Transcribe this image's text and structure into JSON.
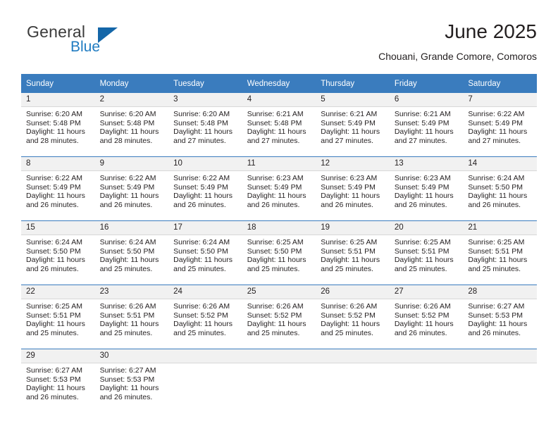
{
  "brand": {
    "name_part1": "General",
    "name_part2": "Blue",
    "accent_color": "#1f7bc1",
    "sail_color": "#1466a8"
  },
  "header": {
    "title": "June 2025",
    "subtitle": "Chouani, Grande Comore, Comoros"
  },
  "calendar": {
    "header_bg": "#3a7cbe",
    "daynum_bg": "#f1f1f1",
    "weekdays": [
      "Sunday",
      "Monday",
      "Tuesday",
      "Wednesday",
      "Thursday",
      "Friday",
      "Saturday"
    ],
    "weeks": [
      [
        {
          "day": "1",
          "sunrise": "Sunrise: 6:20 AM",
          "sunset": "Sunset: 5:48 PM",
          "daylight_line1": "Daylight: 11 hours",
          "daylight_line2": "and 28 minutes."
        },
        {
          "day": "2",
          "sunrise": "Sunrise: 6:20 AM",
          "sunset": "Sunset: 5:48 PM",
          "daylight_line1": "Daylight: 11 hours",
          "daylight_line2": "and 28 minutes."
        },
        {
          "day": "3",
          "sunrise": "Sunrise: 6:20 AM",
          "sunset": "Sunset: 5:48 PM",
          "daylight_line1": "Daylight: 11 hours",
          "daylight_line2": "and 27 minutes."
        },
        {
          "day": "4",
          "sunrise": "Sunrise: 6:21 AM",
          "sunset": "Sunset: 5:48 PM",
          "daylight_line1": "Daylight: 11 hours",
          "daylight_line2": "and 27 minutes."
        },
        {
          "day": "5",
          "sunrise": "Sunrise: 6:21 AM",
          "sunset": "Sunset: 5:49 PM",
          "daylight_line1": "Daylight: 11 hours",
          "daylight_line2": "and 27 minutes."
        },
        {
          "day": "6",
          "sunrise": "Sunrise: 6:21 AM",
          "sunset": "Sunset: 5:49 PM",
          "daylight_line1": "Daylight: 11 hours",
          "daylight_line2": "and 27 minutes."
        },
        {
          "day": "7",
          "sunrise": "Sunrise: 6:22 AM",
          "sunset": "Sunset: 5:49 PM",
          "daylight_line1": "Daylight: 11 hours",
          "daylight_line2": "and 27 minutes."
        }
      ],
      [
        {
          "day": "8",
          "sunrise": "Sunrise: 6:22 AM",
          "sunset": "Sunset: 5:49 PM",
          "daylight_line1": "Daylight: 11 hours",
          "daylight_line2": "and 26 minutes."
        },
        {
          "day": "9",
          "sunrise": "Sunrise: 6:22 AM",
          "sunset": "Sunset: 5:49 PM",
          "daylight_line1": "Daylight: 11 hours",
          "daylight_line2": "and 26 minutes."
        },
        {
          "day": "10",
          "sunrise": "Sunrise: 6:22 AM",
          "sunset": "Sunset: 5:49 PM",
          "daylight_line1": "Daylight: 11 hours",
          "daylight_line2": "and 26 minutes."
        },
        {
          "day": "11",
          "sunrise": "Sunrise: 6:23 AM",
          "sunset": "Sunset: 5:49 PM",
          "daylight_line1": "Daylight: 11 hours",
          "daylight_line2": "and 26 minutes."
        },
        {
          "day": "12",
          "sunrise": "Sunrise: 6:23 AM",
          "sunset": "Sunset: 5:49 PM",
          "daylight_line1": "Daylight: 11 hours",
          "daylight_line2": "and 26 minutes."
        },
        {
          "day": "13",
          "sunrise": "Sunrise: 6:23 AM",
          "sunset": "Sunset: 5:49 PM",
          "daylight_line1": "Daylight: 11 hours",
          "daylight_line2": "and 26 minutes."
        },
        {
          "day": "14",
          "sunrise": "Sunrise: 6:24 AM",
          "sunset": "Sunset: 5:50 PM",
          "daylight_line1": "Daylight: 11 hours",
          "daylight_line2": "and 26 minutes."
        }
      ],
      [
        {
          "day": "15",
          "sunrise": "Sunrise: 6:24 AM",
          "sunset": "Sunset: 5:50 PM",
          "daylight_line1": "Daylight: 11 hours",
          "daylight_line2": "and 26 minutes."
        },
        {
          "day": "16",
          "sunrise": "Sunrise: 6:24 AM",
          "sunset": "Sunset: 5:50 PM",
          "daylight_line1": "Daylight: 11 hours",
          "daylight_line2": "and 25 minutes."
        },
        {
          "day": "17",
          "sunrise": "Sunrise: 6:24 AM",
          "sunset": "Sunset: 5:50 PM",
          "daylight_line1": "Daylight: 11 hours",
          "daylight_line2": "and 25 minutes."
        },
        {
          "day": "18",
          "sunrise": "Sunrise: 6:25 AM",
          "sunset": "Sunset: 5:50 PM",
          "daylight_line1": "Daylight: 11 hours",
          "daylight_line2": "and 25 minutes."
        },
        {
          "day": "19",
          "sunrise": "Sunrise: 6:25 AM",
          "sunset": "Sunset: 5:51 PM",
          "daylight_line1": "Daylight: 11 hours",
          "daylight_line2": "and 25 minutes."
        },
        {
          "day": "20",
          "sunrise": "Sunrise: 6:25 AM",
          "sunset": "Sunset: 5:51 PM",
          "daylight_line1": "Daylight: 11 hours",
          "daylight_line2": "and 25 minutes."
        },
        {
          "day": "21",
          "sunrise": "Sunrise: 6:25 AM",
          "sunset": "Sunset: 5:51 PM",
          "daylight_line1": "Daylight: 11 hours",
          "daylight_line2": "and 25 minutes."
        }
      ],
      [
        {
          "day": "22",
          "sunrise": "Sunrise: 6:25 AM",
          "sunset": "Sunset: 5:51 PM",
          "daylight_line1": "Daylight: 11 hours",
          "daylight_line2": "and 25 minutes."
        },
        {
          "day": "23",
          "sunrise": "Sunrise: 6:26 AM",
          "sunset": "Sunset: 5:51 PM",
          "daylight_line1": "Daylight: 11 hours",
          "daylight_line2": "and 25 minutes."
        },
        {
          "day": "24",
          "sunrise": "Sunrise: 6:26 AM",
          "sunset": "Sunset: 5:52 PM",
          "daylight_line1": "Daylight: 11 hours",
          "daylight_line2": "and 25 minutes."
        },
        {
          "day": "25",
          "sunrise": "Sunrise: 6:26 AM",
          "sunset": "Sunset: 5:52 PM",
          "daylight_line1": "Daylight: 11 hours",
          "daylight_line2": "and 25 minutes."
        },
        {
          "day": "26",
          "sunrise": "Sunrise: 6:26 AM",
          "sunset": "Sunset: 5:52 PM",
          "daylight_line1": "Daylight: 11 hours",
          "daylight_line2": "and 25 minutes."
        },
        {
          "day": "27",
          "sunrise": "Sunrise: 6:26 AM",
          "sunset": "Sunset: 5:52 PM",
          "daylight_line1": "Daylight: 11 hours",
          "daylight_line2": "and 26 minutes."
        },
        {
          "day": "28",
          "sunrise": "Sunrise: 6:27 AM",
          "sunset": "Sunset: 5:53 PM",
          "daylight_line1": "Daylight: 11 hours",
          "daylight_line2": "and 26 minutes."
        }
      ],
      [
        {
          "day": "29",
          "sunrise": "Sunrise: 6:27 AM",
          "sunset": "Sunset: 5:53 PM",
          "daylight_line1": "Daylight: 11 hours",
          "daylight_line2": "and 26 minutes."
        },
        {
          "day": "30",
          "sunrise": "Sunrise: 6:27 AM",
          "sunset": "Sunset: 5:53 PM",
          "daylight_line1": "Daylight: 11 hours",
          "daylight_line2": "and 26 minutes."
        },
        {
          "day": "",
          "sunrise": "",
          "sunset": "",
          "daylight_line1": "",
          "daylight_line2": ""
        },
        {
          "day": "",
          "sunrise": "",
          "sunset": "",
          "daylight_line1": "",
          "daylight_line2": ""
        },
        {
          "day": "",
          "sunrise": "",
          "sunset": "",
          "daylight_line1": "",
          "daylight_line2": ""
        },
        {
          "day": "",
          "sunrise": "",
          "sunset": "",
          "daylight_line1": "",
          "daylight_line2": ""
        },
        {
          "day": "",
          "sunrise": "",
          "sunset": "",
          "daylight_line1": "",
          "daylight_line2": ""
        }
      ]
    ]
  }
}
